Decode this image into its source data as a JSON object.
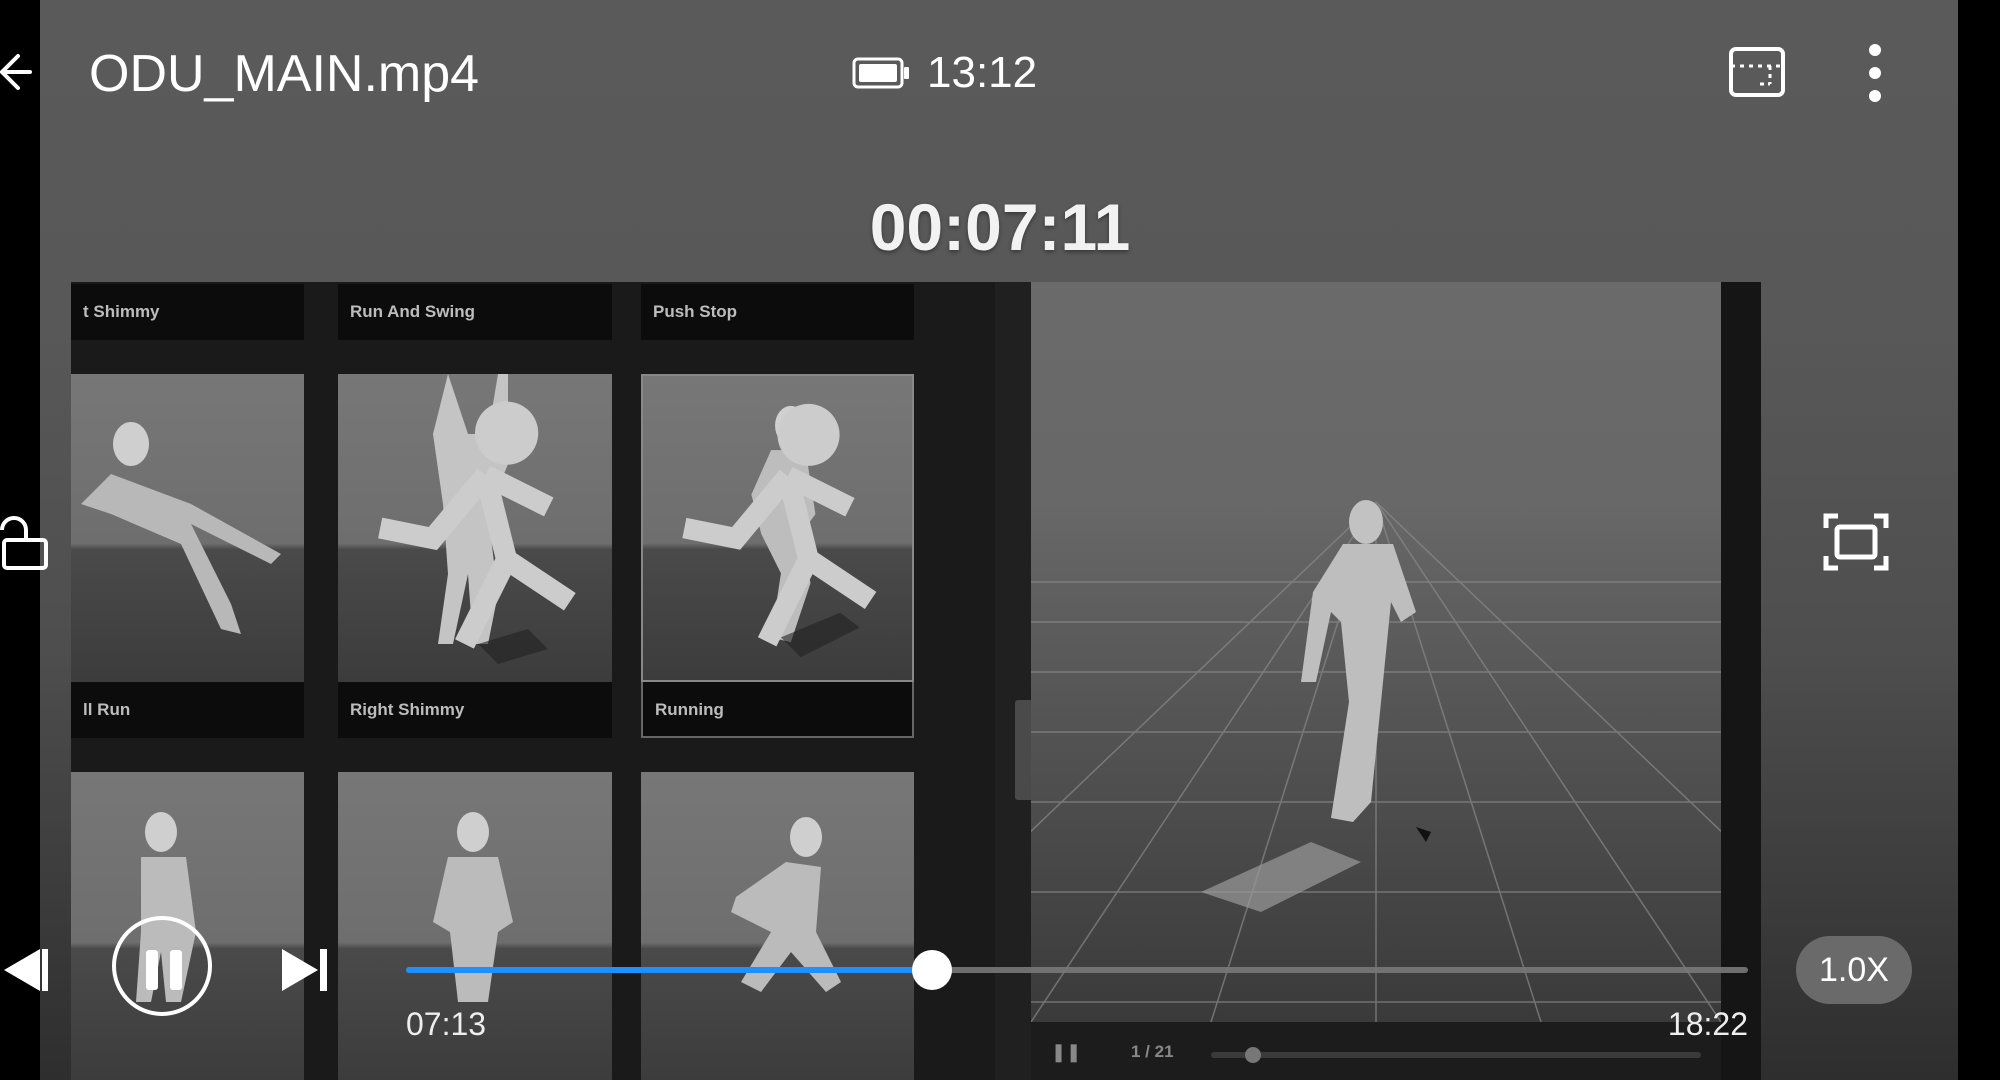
{
  "header": {
    "title": "ODU_MAIN.mp4",
    "clock": "13:12",
    "battery_icon": "battery-icon",
    "cast_icon": "cast-icon",
    "menu_icon": "more-vert-icon"
  },
  "seek_overlay": {
    "time": "00:07:11"
  },
  "side_controls": {
    "lock_icon": "unlock-icon",
    "crop_icon": "crop-fit-icon"
  },
  "video_frame": {
    "library_tiles": [
      {
        "label": "t Shimmy"
      },
      {
        "label": "Run And Swing"
      },
      {
        "label": "Push Stop"
      },
      {
        "label": "ll Run"
      },
      {
        "label": "Right Shimmy"
      },
      {
        "label": "Running"
      }
    ],
    "viewport": {
      "frame_counter": "1 / 21"
    }
  },
  "playback": {
    "current_time": "07:13",
    "duration": "18:22",
    "progress_fraction": 0.392,
    "speed_label": "1.0X",
    "accent_color": "#1e90ff"
  }
}
